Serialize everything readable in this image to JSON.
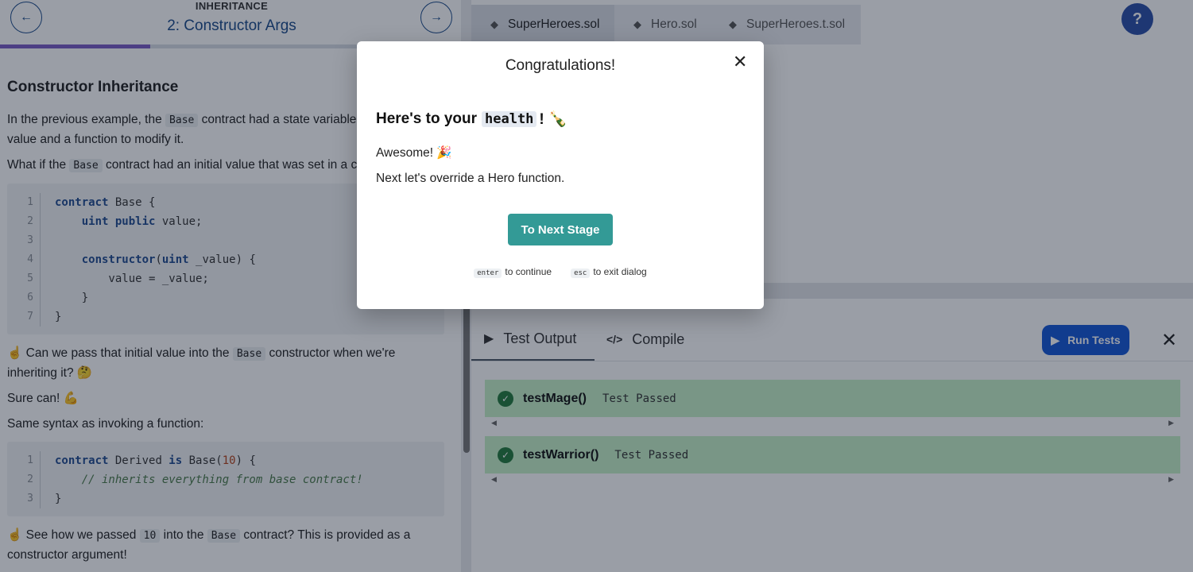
{
  "lesson": {
    "section": "INHERITANCE",
    "stage_title": "2: Constructor Args",
    "progress_fraction": 0.325,
    "heading": "Constructor Inheritance",
    "p1_before": "In the previous example, the",
    "p1_code": "Base",
    "p1_after": "contract had a state variable with an initial value and a function to modify it.",
    "p2_before": "What if the",
    "p2_code": "Base",
    "p2_after": "contract had an initial value that was set in a constructor?",
    "code1": [
      {
        "n": "1",
        "t": "contract Base {"
      },
      {
        "n": "2",
        "t": "    uint public value;"
      },
      {
        "n": "3",
        "t": ""
      },
      {
        "n": "4",
        "t": "    constructor(uint _value) {"
      },
      {
        "n": "5",
        "t": "        value = _value;"
      },
      {
        "n": "6",
        "t": "    }"
      },
      {
        "n": "7",
        "t": "}"
      }
    ],
    "p3_emoji": "☝️",
    "p3_before": "Can we pass that initial value into the",
    "p3_code": "Base",
    "p3_after": "constructor when we're inheriting it? 🤔",
    "p4": "Sure can! 💪",
    "p5": "Same syntax as invoking a function:",
    "code2": [
      {
        "n": "1",
        "t": "contract Derived is Base(10) {"
      },
      {
        "n": "2",
        "t": "    // inherits everything from base contract!"
      },
      {
        "n": "3",
        "t": "}"
      }
    ],
    "p6_before": "☝️ See how we passed",
    "p6_code1": "10",
    "p6_mid": "into the",
    "p6_code2": "Base",
    "p6_after": "contract? This is provided as a constructor argument!"
  },
  "editor": {
    "tabs": [
      "SuperHeroes.sol",
      "Hero.sol",
      "SuperHeroes.t.sol"
    ],
    "active_tab": 0,
    "help_label": "?"
  },
  "test_panel": {
    "tab_output": "Test Output",
    "tab_compile": "Compile",
    "run_label": "Run Tests",
    "results": [
      {
        "name": "testMage()",
        "status": "Test Passed"
      },
      {
        "name": "testWarrior()",
        "status": "Test Passed"
      }
    ]
  },
  "modal": {
    "title": "Congratulations!",
    "heading_before": "Here's to your",
    "heading_code": "health",
    "heading_after": "! 🍾",
    "line1": "Awesome! 🎉",
    "line2": "Next let's override a Hero function.",
    "button": "To Next Stage",
    "hint_key1": "enter",
    "hint_text1": "to continue",
    "hint_key2": "esc",
    "hint_text2": "to exit dialog"
  },
  "colors": {
    "primary": "#1a4a8a",
    "progress": "#7b5cc4",
    "run_button": "#1456d6",
    "next_button": "#339a96",
    "test_pass_bg": "#c6f2c8"
  }
}
